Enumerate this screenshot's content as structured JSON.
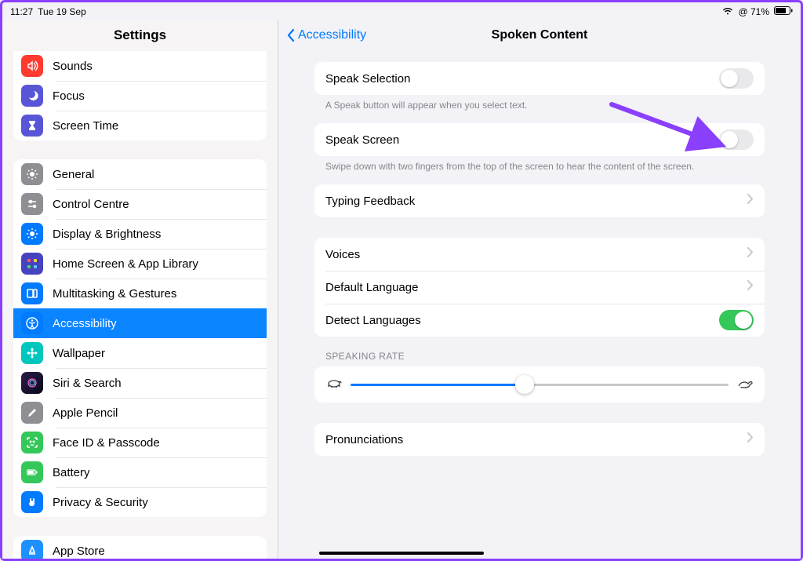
{
  "status": {
    "time": "11:27",
    "date": "Tue 19 Sep",
    "battery": "71%"
  },
  "sidebar": {
    "title": "Settings",
    "group0": [
      {
        "label": "Sounds",
        "color": "#ff3b30",
        "glyph": "sounds-icon"
      },
      {
        "label": "Focus",
        "color": "#5856d6",
        "glyph": "moon-icon"
      },
      {
        "label": "Screen Time",
        "color": "#5856d6",
        "glyph": "hourglass-icon"
      }
    ],
    "group1": [
      {
        "label": "General",
        "color": "#8e8e93",
        "glyph": "gear-icon"
      },
      {
        "label": "Control Centre",
        "color": "#8e8e93",
        "glyph": "sliders-icon"
      },
      {
        "label": "Display & Brightness",
        "color": "#007aff",
        "glyph": "sun-icon"
      },
      {
        "label": "Home Screen & App Library",
        "color": "#4543c0",
        "glyph": "grid-icon"
      },
      {
        "label": "Multitasking & Gestures",
        "color": "#007aff",
        "glyph": "multitask-icon"
      },
      {
        "label": "Accessibility",
        "color": "#007aff",
        "glyph": "accessibility-icon",
        "selected": true
      },
      {
        "label": "Wallpaper",
        "color": "#00c7be",
        "glyph": "flower-icon"
      },
      {
        "label": "Siri & Search",
        "color": "#1f1f3a",
        "glyph": "siri-icon"
      },
      {
        "label": "Apple Pencil",
        "color": "#8e8e93",
        "glyph": "pencil-icon"
      },
      {
        "label": "Face ID & Passcode",
        "color": "#34c759",
        "glyph": "faceid-icon"
      },
      {
        "label": "Battery",
        "color": "#34c759",
        "glyph": "battery-icon"
      },
      {
        "label": "Privacy & Security",
        "color": "#007aff",
        "glyph": "hand-icon"
      }
    ],
    "group2": [
      {
        "label": "App Store",
        "color": "#1e90ff",
        "glyph": "appstore-icon"
      }
    ]
  },
  "detail": {
    "back_label": "Accessibility",
    "title": "Spoken Content",
    "speak_selection": {
      "label": "Speak Selection",
      "on": false,
      "hint": "A Speak button will appear when you select text."
    },
    "speak_screen": {
      "label": "Speak Screen",
      "on": false,
      "hint": "Swipe down with two fingers from the top of the screen to hear the content of the screen."
    },
    "typing_feedback": "Typing Feedback",
    "voices": "Voices",
    "default_language": "Default Language",
    "detect_languages": {
      "label": "Detect Languages",
      "on": true
    },
    "speaking_rate_header": "SPEAKING RATE",
    "speaking_rate_value": 0.46,
    "pronunciations": "Pronunciations"
  }
}
